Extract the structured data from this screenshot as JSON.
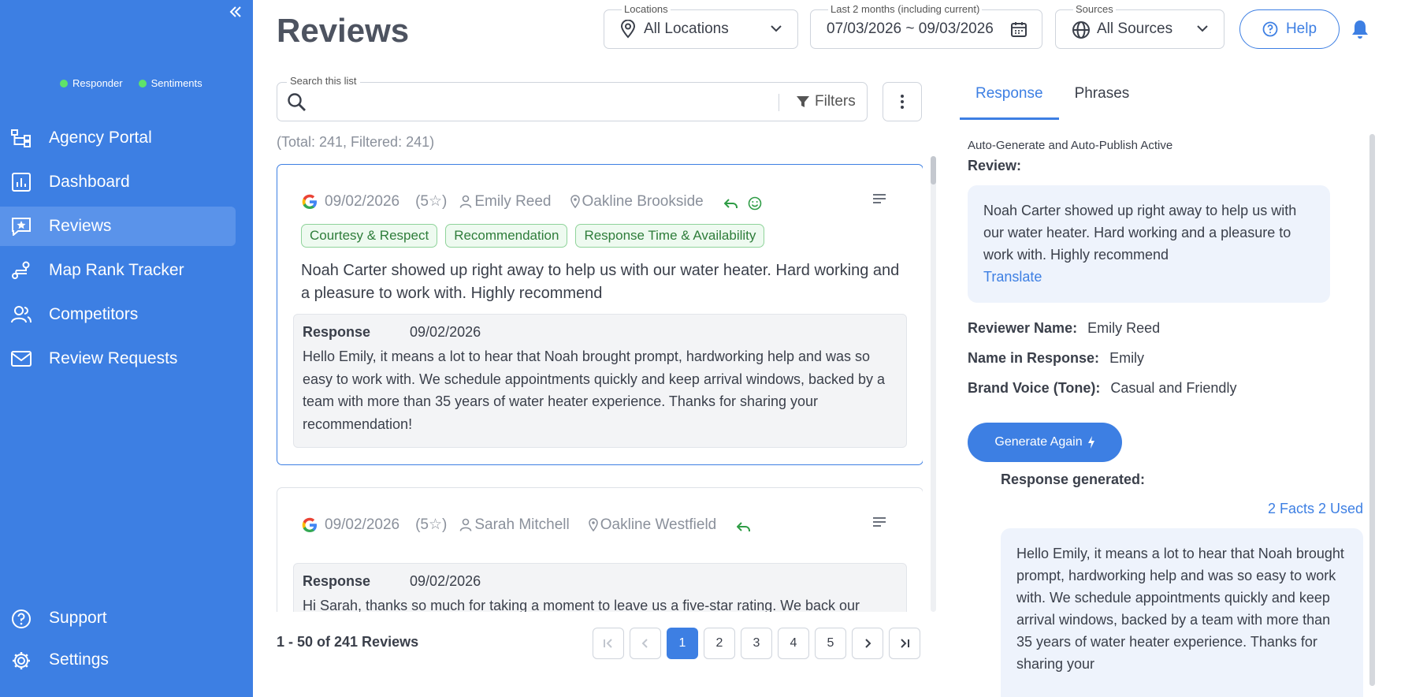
{
  "sidebar": {
    "collapse_icon": "double-chevron-left",
    "toggles": [
      {
        "label": "Responder",
        "color": "#5fe36a"
      },
      {
        "label": "Sentiments",
        "color": "#5fe36a"
      }
    ],
    "items": [
      {
        "label": "Agency Portal",
        "icon": "sitemap-icon"
      },
      {
        "label": "Dashboard",
        "icon": "chart-icon"
      },
      {
        "label": "Reviews",
        "icon": "star-message-icon",
        "active": true
      },
      {
        "label": "Map Rank Tracker",
        "icon": "route-icon"
      },
      {
        "label": "Competitors",
        "icon": "users-icon"
      },
      {
        "label": "Review Requests",
        "icon": "mail-icon"
      }
    ],
    "bottom_items": [
      {
        "label": "Support",
        "icon": "help-circle-icon"
      },
      {
        "label": "Settings",
        "icon": "gear-icon"
      }
    ],
    "color": "#3d7fe3"
  },
  "header": {
    "title": "Reviews",
    "locations": {
      "label": "Locations",
      "value": "All Locations"
    },
    "date_range": {
      "label": "Last 2 months (including current)",
      "value": "07/03/2026 ~ 09/03/2026"
    },
    "sources": {
      "label": "Sources",
      "value": "All Sources"
    },
    "help_label": "Help"
  },
  "search": {
    "label": "Search this list",
    "value": "",
    "filters_label": "Filters",
    "totals": "(Total: 241, Filtered: 241)"
  },
  "reviews": [
    {
      "date": "09/02/2026",
      "rating": "(5☆)",
      "reviewer": "Emily Reed",
      "location": "Oakline Brookside",
      "tags": [
        "Courtesy & Respect",
        "Recommendation",
        "Response Time & Availability"
      ],
      "text": "Noah Carter showed up right away to help us with our water heater. Hard working and a pleasure to work with. Highly recommend",
      "response_label": "Response",
      "response_date": "09/02/2026",
      "response_text": "Hello Emily, it means a lot to hear that Noah brought prompt, hardworking help and was so easy to work with. We schedule appointments quickly and keep arrival windows, backed by a team with more than 35 years of water heater experience. Thanks for sharing your recommendation!"
    },
    {
      "date": "09/02/2026",
      "rating": "(5☆)",
      "reviewer": "Sarah Mitchell",
      "location": "Oakline Westfield",
      "tags": [],
      "text": "",
      "response_label": "Response",
      "response_date": "09/02/2026",
      "response_text": "Hi Sarah, thanks so much for taking a moment to leave us a five-star rating.  We back our"
    }
  ],
  "pagination": {
    "info": "1 - 50 of 241 Reviews",
    "pages": [
      "1",
      "2",
      "3",
      "4",
      "5"
    ],
    "current": "1"
  },
  "right_panel": {
    "tabs": [
      "Response",
      "Phrases"
    ],
    "active_tab": "Response",
    "auto_line": "Auto-Generate and Auto-Publish Active",
    "review_label": "Review:",
    "review_text": "Noah Carter showed up right away to help us with our water heater. Hard working and a pleasure to work with. Highly recommend",
    "translate_label": "Translate",
    "reviewer_name_label": "Reviewer Name:",
    "reviewer_name": "Emily Reed",
    "name_in_response_label": "Name in Response:",
    "name_in_response": "Emily",
    "brand_voice_label": "Brand Voice (Tone):",
    "brand_voice": "Casual and Friendly",
    "generate_label": "Generate Again",
    "response_generated_label": "Response generated:",
    "facts_label": "2 Facts 2 Used",
    "generated_text": "Hello Emily, it means a lot to hear that Noah brought prompt, hardworking help and was so easy to work with. We schedule appointments quickly and keep arrival windows, backed by a team with more than 35 years of water heater experience. Thanks for sharing your"
  },
  "colors": {
    "accent": "#3d7fe3",
    "positive": "#2e7d3a",
    "google_red": "#ea4335"
  }
}
